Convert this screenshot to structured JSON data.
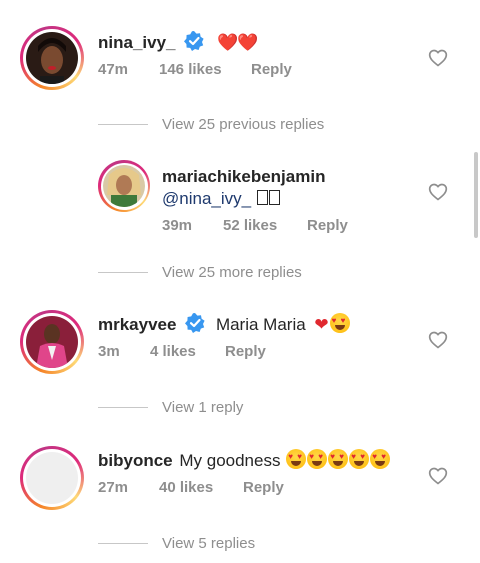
{
  "colors": {
    "muted": "#8e8e8e",
    "heart_red": "#e0282f",
    "verified_blue": "#3897f0",
    "text": "#262626"
  },
  "comments": [
    {
      "username": "nina_ivy_",
      "verified": true,
      "text": "❤️❤️",
      "time": "47m",
      "likes": "146 likes",
      "reply": "Reply",
      "avatar": "avatar-woman-red-lips",
      "view_replies": "View 25 previous replies"
    },
    {
      "username": "mariachikebenjamin",
      "verified": false,
      "mention": "@nina_ivy_",
      "text_suffix": "😍😍",
      "time": "39m",
      "likes": "52 likes",
      "reply": "Reply",
      "avatar": "avatar-woman-blonde",
      "view_replies": "View 25 more replies"
    },
    {
      "username": "mrkayvee",
      "verified": true,
      "text": "Maria Maria",
      "time": "3m",
      "likes": "4 likes",
      "reply": "Reply",
      "avatar": "avatar-man-pink-suit",
      "view_replies": "View 1 reply"
    },
    {
      "username": "bibyonce",
      "verified": false,
      "text": "My goodness",
      "time": "27m",
      "likes": "40 likes",
      "reply": "Reply",
      "avatar": "avatar-blank",
      "view_replies": "View 5 replies"
    }
  ]
}
